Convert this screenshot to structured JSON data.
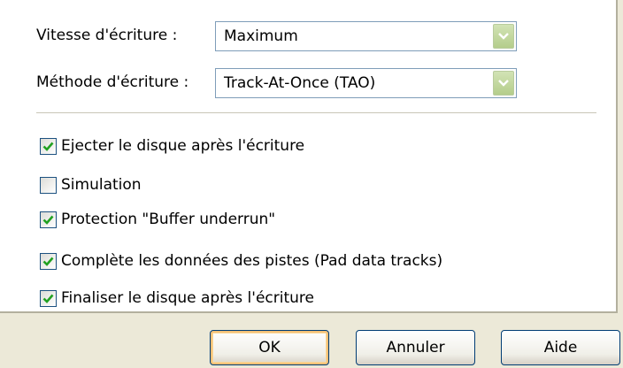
{
  "form": {
    "write_speed": {
      "label": "Vitesse d'écriture :",
      "value": "Maximum"
    },
    "write_method": {
      "label": "Méthode d'écriture :",
      "value": "Track-At-Once (TAO)"
    },
    "options": [
      {
        "label": "Ejecter le disque après l'écriture",
        "checked": true
      },
      {
        "label": "Simulation",
        "checked": false
      },
      {
        "label": "Protection \"Buffer underrun\"",
        "checked": true
      },
      {
        "label": "Complète les données des pistes (Pad data tracks)",
        "checked": true
      },
      {
        "label": "Finaliser le disque après l'écriture",
        "checked": true
      }
    ]
  },
  "buttons": {
    "ok": "OK",
    "cancel": "Annuler",
    "help": "Aide"
  },
  "colors": {
    "dialog_bg": "#ece9d8",
    "panel_bg": "#ffffff",
    "check_mark": "#21a121",
    "combo_arrow": "#b4cd8b"
  }
}
